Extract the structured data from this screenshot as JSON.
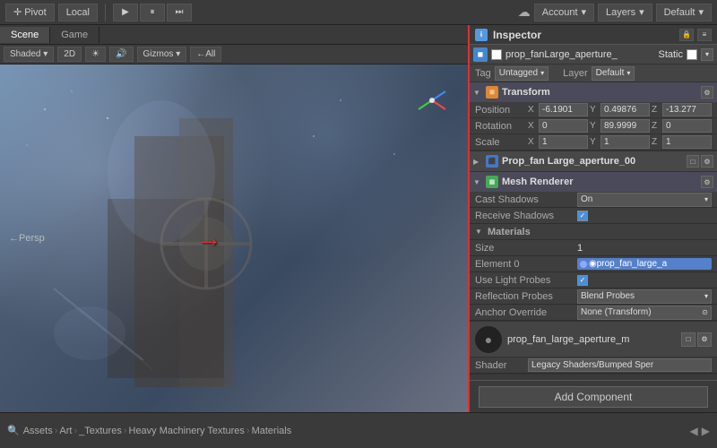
{
  "toolbar": {
    "pivot_label": "Pivot",
    "local_label": "Local",
    "play_label": "▶",
    "pause_label": "⏸",
    "step_label": "⏭",
    "account_label": "Account",
    "layers_label": "Layers",
    "default_label": "Default"
  },
  "scene": {
    "tab_scene": "Scene",
    "tab_game": "Game",
    "shaded_label": "Shaded",
    "mode_label": "2D",
    "gizmos_label": "Gizmos",
    "persp_label": "←Persp",
    "red_arrow": "→"
  },
  "inspector": {
    "title": "Inspector",
    "lock_icon": "🔒",
    "menu_icon": "≡",
    "object_icon": "◼",
    "object_name": "prop_fanLarge_aperture_",
    "static_label": "Static",
    "tag_label": "Tag",
    "tag_value": "Untagged",
    "layer_label": "Layer",
    "layer_value": "Default"
  },
  "transform": {
    "section_name": "Transform",
    "position_label": "Position",
    "rotation_label": "Rotation",
    "scale_label": "Scale",
    "pos_x": "-6.1901",
    "pos_y": "0.49876",
    "pos_z": "-13.277",
    "rot_x": "0",
    "rot_y": "89.9999",
    "rot_z": "0",
    "scale_x": "1",
    "scale_y": "1",
    "scale_z": "1"
  },
  "prop_fan_component": {
    "section_name": "Prop_fan Large_aperture_00",
    "icon": "⬛"
  },
  "mesh_renderer": {
    "section_name": "Mesh Renderer",
    "cast_shadows_label": "Cast Shadows",
    "cast_shadows_value": "On",
    "receive_shadows_label": "Receive Shadows",
    "materials_label": "Materials",
    "size_label": "Size",
    "size_value": "1",
    "element0_label": "Element 0",
    "element0_value": "◉prop_fan_large_a",
    "use_light_probes_label": "Use Light Probes",
    "reflection_probes_label": "Reflection Probes",
    "reflection_probes_value": "Blend Probes",
    "anchor_override_label": "Anchor Override",
    "anchor_override_value": "None (Transform)"
  },
  "material_section": {
    "name": "prop_fan_large_aperture_m",
    "shader_label": "Shader",
    "shader_value": "Legacy Shaders/Bumped Sper"
  },
  "footer": {
    "add_component_label": "Add Component",
    "assets_label": "Assets",
    "art_label": "Art",
    "textures_label": "_Textures",
    "heavy_label": "Heavy Machinery Textures",
    "materials_label": "Materials"
  }
}
